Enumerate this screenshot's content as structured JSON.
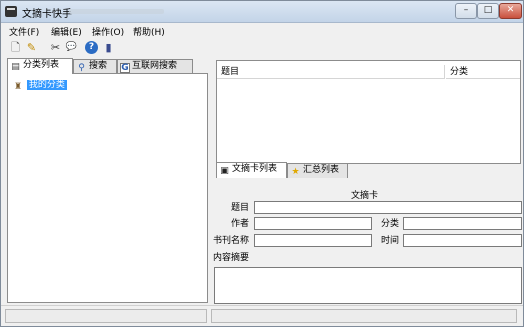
{
  "window": {
    "title": "文摘卡快手"
  },
  "caption": {
    "minimize": "–",
    "maximize": "□",
    "close": "✕"
  },
  "menu": [
    {
      "label": "文件(F)"
    },
    {
      "label": "编辑(E)"
    },
    {
      "label": "操作(O)"
    },
    {
      "label": "帮助(H)"
    }
  ],
  "toolbar": [
    {
      "icon": "new-document-icon",
      "glyph": "🗋"
    },
    {
      "icon": "edit-icon",
      "glyph": "✎"
    },
    {
      "icon": "cut-icon",
      "glyph": "✂"
    },
    {
      "icon": "comment-icon",
      "glyph": "💬"
    },
    {
      "icon": "help-icon",
      "glyph": "?"
    },
    {
      "icon": "book-icon",
      "glyph": "▮"
    }
  ],
  "left_tabs": [
    {
      "label": "分类列表",
      "icon": "category-icon"
    },
    {
      "label": "搜索",
      "icon": "search-icon"
    },
    {
      "label": "互联网搜索",
      "icon": "google-icon"
    }
  ],
  "tree": {
    "root_label": "我的分类"
  },
  "table": {
    "columns": [
      "题目",
      "分类"
    ]
  },
  "right_tabs": [
    {
      "label": "文摘卡列表",
      "icon": "card-list-icon"
    },
    {
      "label": "汇总列表",
      "icon": "star-icon"
    }
  ],
  "form": {
    "heading": "文摘卡",
    "title_label": "题目",
    "author_label": "作者",
    "category_label": "分类",
    "book_label": "书刊名称",
    "time_label": "时间",
    "summary_label": "内容摘要",
    "title_value": "",
    "author_value": "",
    "category_value": "",
    "book_value": "",
    "time_value": ""
  }
}
